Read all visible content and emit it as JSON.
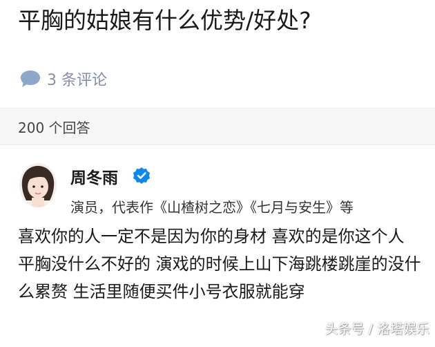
{
  "question": {
    "title": "平胸的姑娘有什么优势/好处?"
  },
  "comments": {
    "label": "3 条评论",
    "icon": "comment-bubble-icon",
    "icon_color": "#8ea6c9"
  },
  "answers": {
    "count_label": "200 个回答"
  },
  "answer": {
    "author": {
      "name": "周冬雨",
      "verified_icon": "verified-check-icon",
      "verified_color": "#0f88eb",
      "bio": "演员，代表作《山楂树之恋》《七月与安生》等"
    },
    "paragraphs": [
      "喜欢你的人一定不是因为你的身材 喜欢的是你这个人",
      "平胸没什么不好的 演戏的时候上山下海跳楼跳崖的没什么累赘 生活里随便买件小号衣服就能穿"
    ]
  },
  "watermark": {
    "text": "头条号 / 洛塔娱乐"
  }
}
